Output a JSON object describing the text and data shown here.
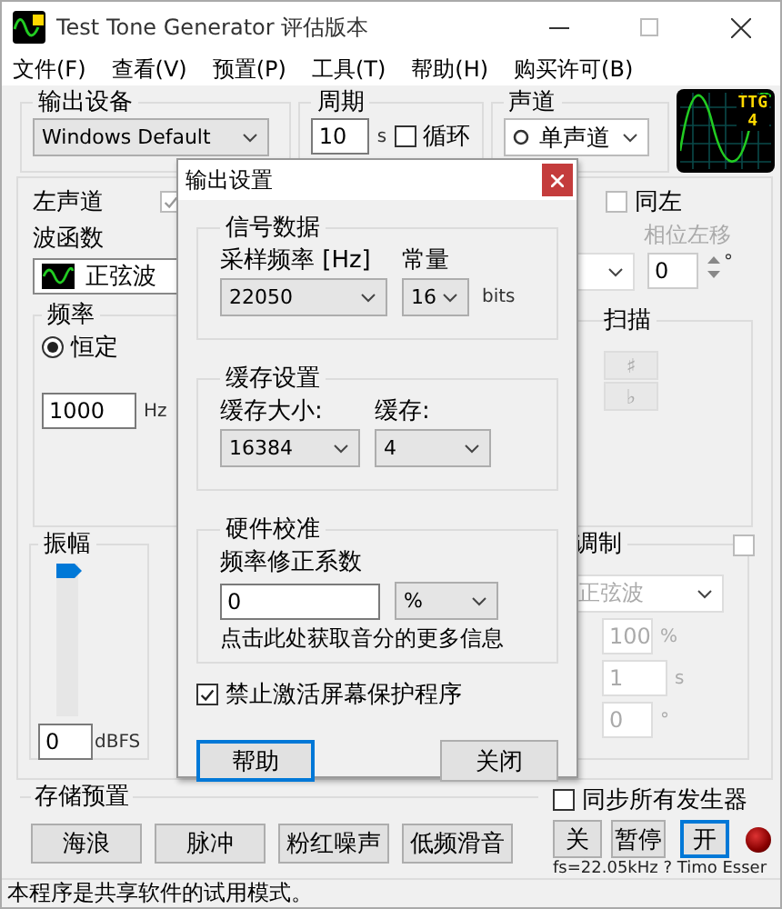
{
  "window": {
    "title": "Test Tone Generator 评估版本"
  },
  "menu": [
    "文件(F)",
    "查看(V)",
    "预置(P)",
    "工具(T)",
    "帮助(H)",
    "购买许可(B)"
  ],
  "output_device": {
    "title": "输出设备",
    "value": "Windows Default"
  },
  "period": {
    "title": "周期",
    "value": "10",
    "unit": "s",
    "loop": {
      "label": "循环",
      "checked": false
    }
  },
  "channel_mode": {
    "title": "声道",
    "value": "单声道"
  },
  "logo": [
    "TTG",
    "4"
  ],
  "left_channel": {
    "title": "左声道",
    "checked": true,
    "waveform_label": "波函数",
    "waveform": "正弦波",
    "frequency": {
      "title": "频率",
      "mode": {
        "label": "恒定",
        "selected": true
      },
      "value": "1000",
      "unit": "Hz"
    }
  },
  "right_panel": {
    "same_as_left": {
      "label": "同左",
      "checked": false
    },
    "phase": {
      "label": "相位左移",
      "value": "0",
      "unit": "°"
    },
    "sweep": {
      "title": "扫描",
      "buttons": [
        "♯",
        "♭"
      ]
    }
  },
  "amplitude": {
    "title": "振幅",
    "level": 1,
    "value": "0",
    "unit": "dBFS"
  },
  "modulation": {
    "title": "调制",
    "checked": false,
    "waveform": "正弦波",
    "fields": [
      {
        "value": "100",
        "unit": "%"
      },
      {
        "value": "1",
        "unit": "s"
      },
      {
        "value": "0",
        "unit": "°"
      }
    ]
  },
  "presets": {
    "title": "存储预置",
    "buttons": [
      "海浪",
      "脉冲",
      "粉红噪声",
      "低频滑音"
    ]
  },
  "sync": {
    "label": "同步所有发生器",
    "checked": false
  },
  "transport": [
    {
      "label": "关",
      "focused": false
    },
    {
      "label": "暂停",
      "focused": false
    },
    {
      "label": "开",
      "focused": true
    }
  ],
  "footer": "fs=22.05kHz ? Timo Esser",
  "status_bar": "本程序是共享软件的试用模式。",
  "dialog": {
    "title": "输出设置",
    "groups": [
      {
        "title": "信号数据",
        "fields": [
          {
            "label": "采样频率 [Hz]",
            "value": "22050"
          },
          {
            "label": "常量",
            "value": "16",
            "unit": "bits"
          }
        ]
      },
      {
        "title": "缓存设置",
        "fields": [
          {
            "label": "缓存大小:",
            "value": "16384"
          },
          {
            "label": "缓存:",
            "value": "4"
          }
        ]
      }
    ],
    "calibration": {
      "title": "硬件校准",
      "label": "频率修正系数",
      "value": "0",
      "unit": "%",
      "link": "点击此处获取音分的更多信息"
    },
    "screensaver": {
      "label": "禁止激活屏幕保护程序",
      "checked": true
    },
    "buttons": [
      {
        "label": "帮助",
        "focused": true
      },
      {
        "label": "关闭",
        "focused": false
      }
    ]
  }
}
